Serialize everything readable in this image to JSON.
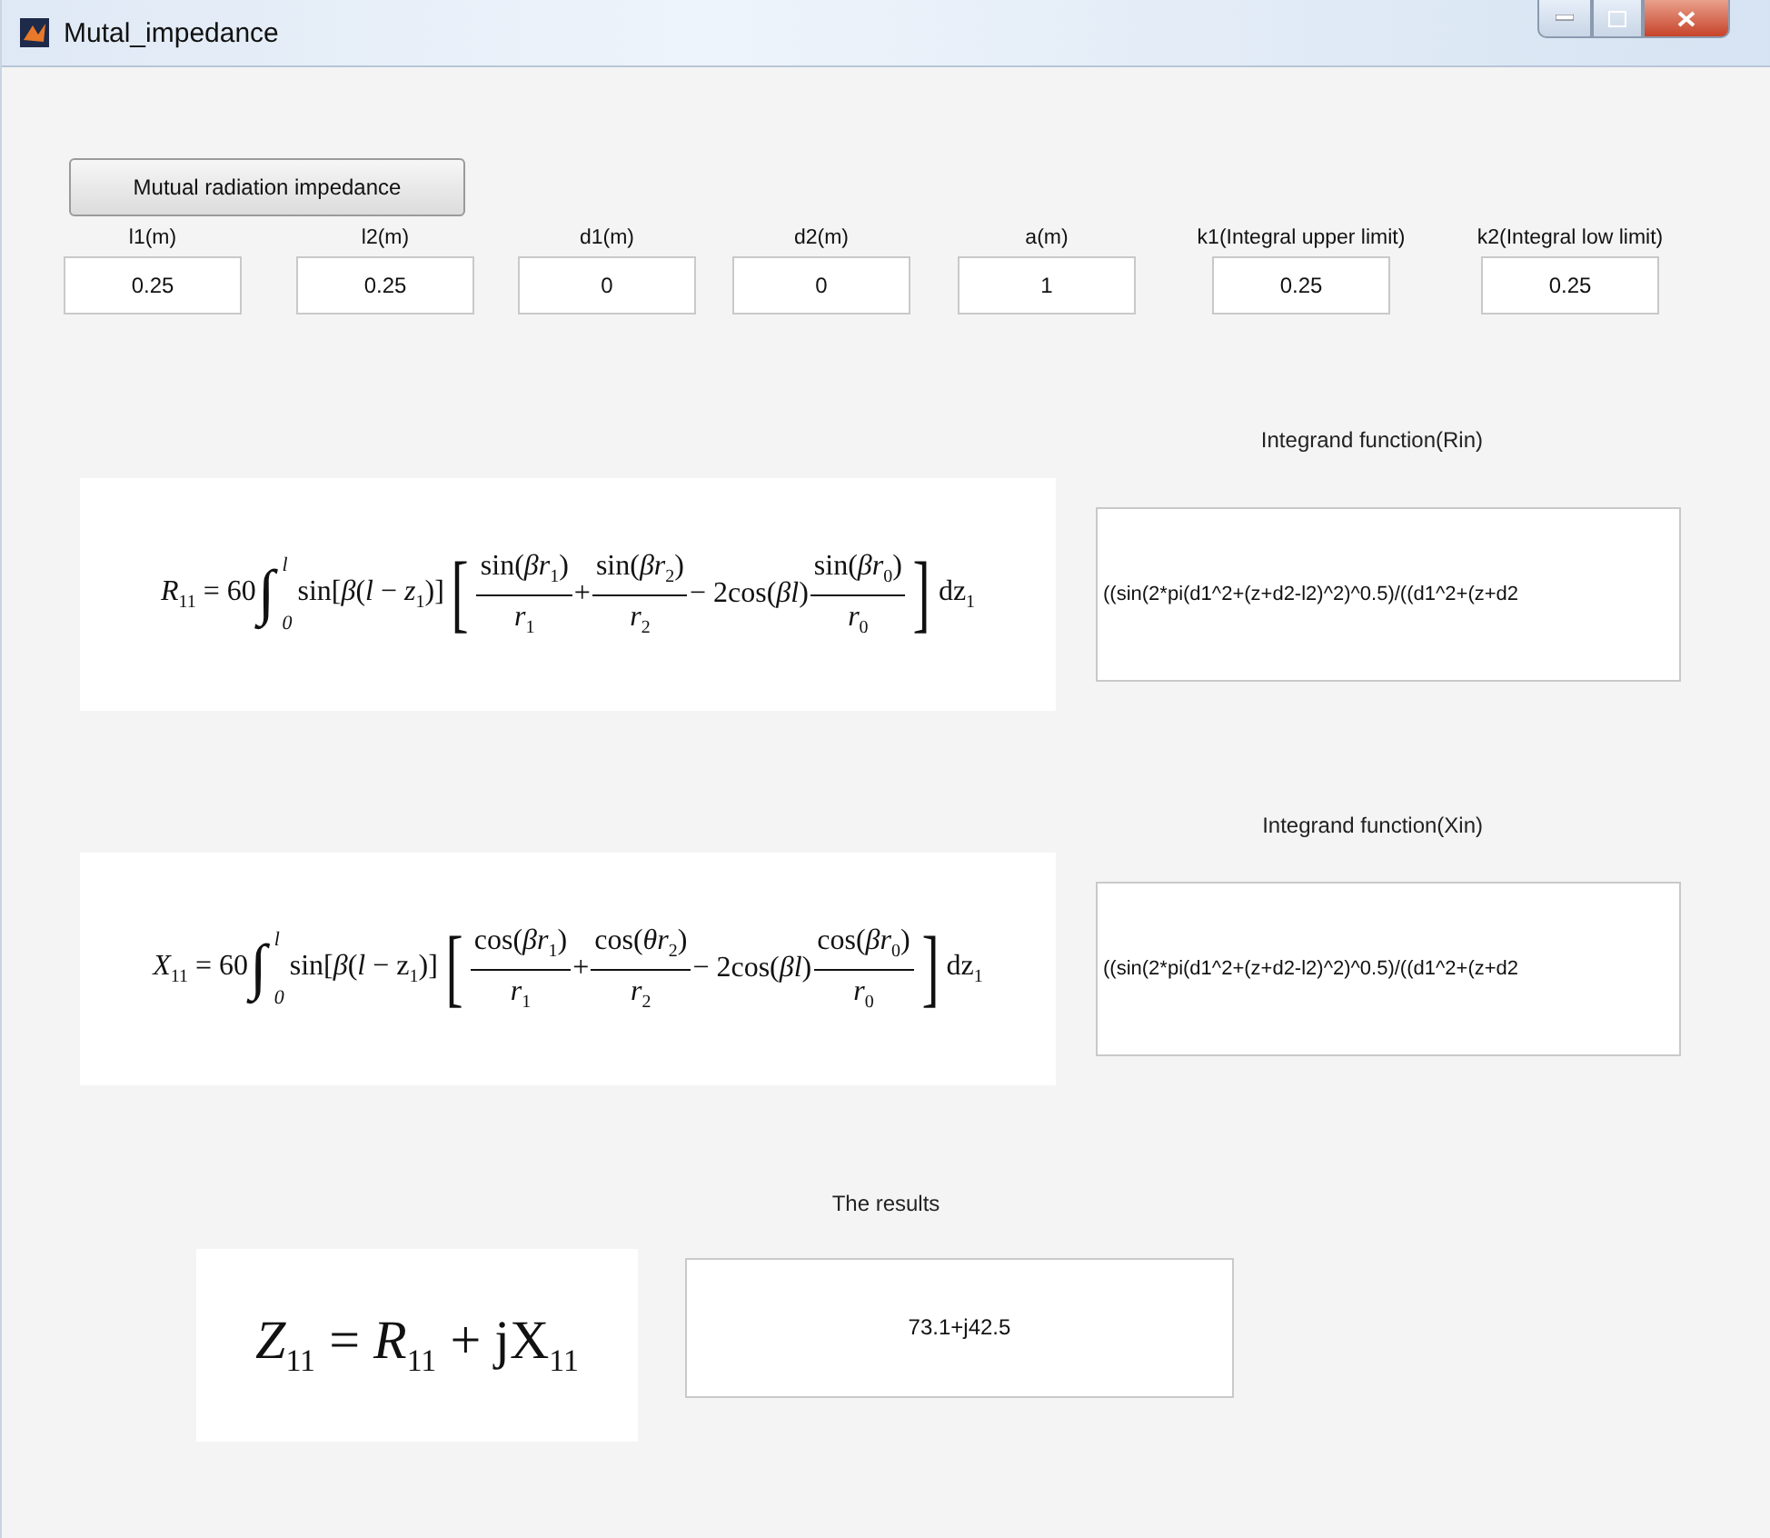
{
  "window": {
    "title": "Mutal_impedance"
  },
  "action_button": {
    "label": "Mutual radiation impedance"
  },
  "parameters": [
    {
      "label": "l1(m)",
      "value": "0.25"
    },
    {
      "label": "l2(m)",
      "value": "0.25"
    },
    {
      "label": "d1(m)",
      "value": "0"
    },
    {
      "label": "d2(m)",
      "value": "0"
    },
    {
      "label": "a(m)",
      "value": "1"
    },
    {
      "label": "k1(Integral upper limit)",
      "value": "0.25"
    },
    {
      "label": "k2(Integral low limit)",
      "value": "0.25"
    }
  ],
  "integrands": [
    {
      "label": "Integrand function(Rin)",
      "value": "((sin(2*pi(d1^2+(z+d2-l2)^2)^0.5)/((d1^2+(z+d2",
      "formula": [
        {
          "kind": "text",
          "text": "*R*$_{11}$ = 60"
        },
        {
          "kind": "integral",
          "sign": "∫",
          "upper": "l",
          "lower": "0"
        },
        {
          "kind": "text",
          "text": "sin[*β*(*l* − *z*$_{1}$)]"
        },
        {
          "kind": "bracket",
          "text": "["
        },
        {
          "kind": "frac",
          "num": "sin(*βr*$_{1}$)",
          "den": "*r*$_{1}$"
        },
        {
          "kind": "text",
          "text": "+"
        },
        {
          "kind": "frac",
          "num": "sin(*βr*$_{2}$)",
          "den": "*r*$_{2}$"
        },
        {
          "kind": "text",
          "text": "− 2cos(*βl*)"
        },
        {
          "kind": "frac",
          "num": "sin(*βr*$_{0}$)",
          "den": "*r*$_{0}$"
        },
        {
          "kind": "bracket",
          "text": "]"
        },
        {
          "kind": "text",
          "text": "dz$_{1}$"
        }
      ]
    },
    {
      "label": "Integrand function(Xin)",
      "value": "((sin(2*pi(d1^2+(z+d2-l2)^2)^0.5)/((d1^2+(z+d2",
      "formula": [
        {
          "kind": "text",
          "text": "*X*$_{11}$ = 60"
        },
        {
          "kind": "integral",
          "sign": "∫",
          "upper": "l",
          "lower": "0"
        },
        {
          "kind": "text",
          "text": "sin[*β*(*l* − z$_{1}$)]"
        },
        {
          "kind": "bracket",
          "text": "["
        },
        {
          "kind": "frac",
          "num": "cos(*βr*$_{1}$)",
          "den": "*r*$_{1}$"
        },
        {
          "kind": "text",
          "text": "+"
        },
        {
          "kind": "frac",
          "num": "cos(*θr*$_{2}$)",
          "den": "*r*$_{2}$"
        },
        {
          "kind": "text",
          "text": "− 2cos(*βl*)"
        },
        {
          "kind": "frac",
          "num": "cos(*βr*$_{0}$)",
          "den": "*r*$_{0}$"
        },
        {
          "kind": "bracket",
          "text": "]"
        },
        {
          "kind": "text",
          "text": "dz$_{1}$"
        }
      ]
    }
  ],
  "results": {
    "label": "The results",
    "formula": "*Z*$_{11}$ = *R*$_{11}$ + jX$_{11}$",
    "value": "73.1+j42.5"
  }
}
